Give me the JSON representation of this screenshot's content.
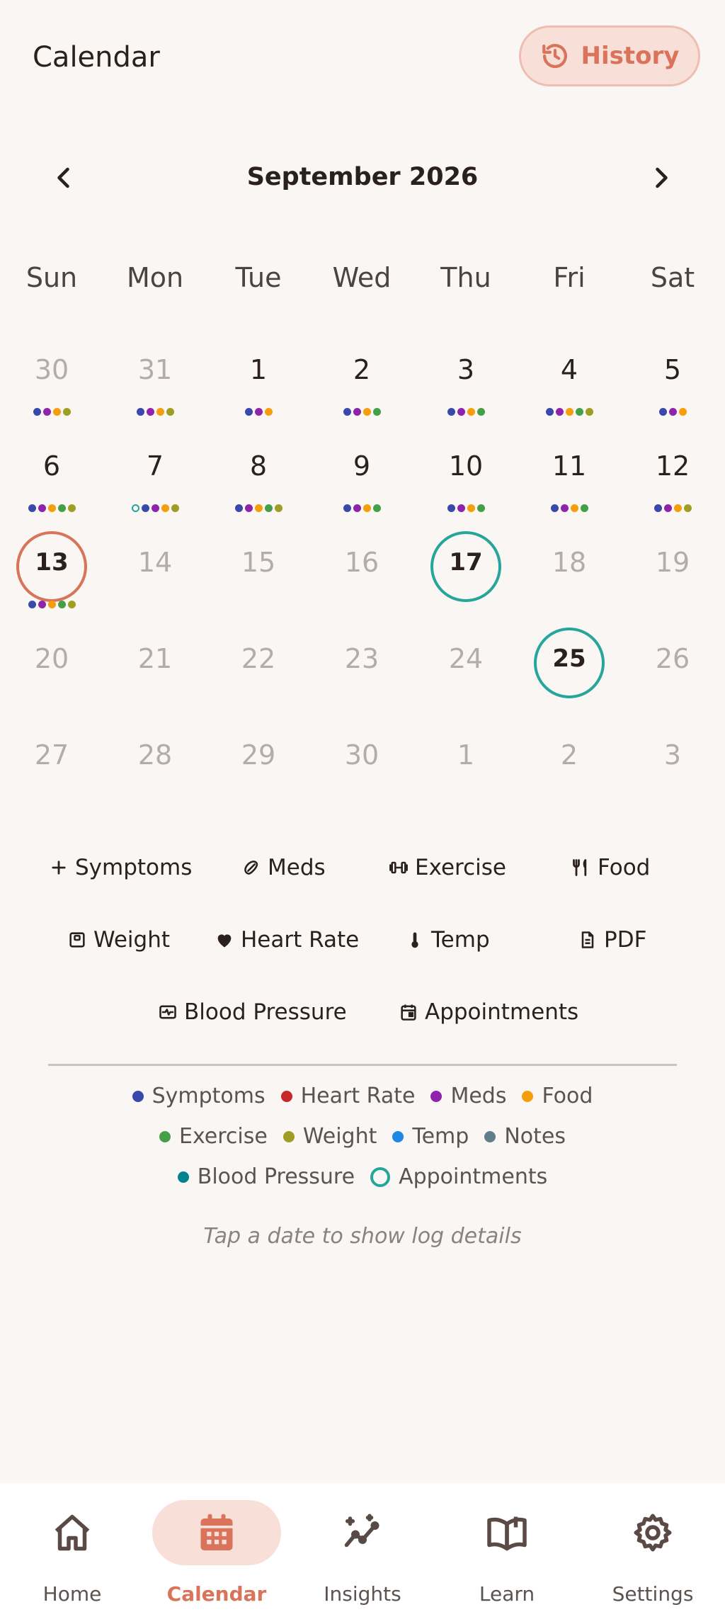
{
  "header": {
    "title": "Calendar",
    "history_label": "History"
  },
  "month": {
    "label": "September 2026"
  },
  "weekdays": [
    "Sun",
    "Mon",
    "Tue",
    "Wed",
    "Thu",
    "Fri",
    "Sat"
  ],
  "colors": {
    "symptoms": "#3949ab",
    "heart_rate": "#c62828",
    "meds": "#8e24aa",
    "food": "#f59e0b",
    "exercise": "#43a047",
    "weight": "#9e9d24",
    "temp": "#1e88e5",
    "notes": "#607d8b",
    "blood_pressure": "#00838f",
    "appointments": "#26a69a",
    "accent": "#d9735a"
  },
  "days": [
    {
      "label": "30",
      "muted": true,
      "dots": [
        "symptoms",
        "meds",
        "food",
        "weight"
      ]
    },
    {
      "label": "31",
      "muted": true,
      "dots": [
        "symptoms",
        "meds",
        "food",
        "weight"
      ]
    },
    {
      "label": "1",
      "dots": [
        "symptoms",
        "meds",
        "food"
      ]
    },
    {
      "label": "2",
      "dots": [
        "symptoms",
        "meds",
        "food",
        "exercise"
      ]
    },
    {
      "label": "3",
      "dots": [
        "symptoms",
        "meds",
        "food",
        "exercise"
      ]
    },
    {
      "label": "4",
      "dots": [
        "symptoms",
        "meds",
        "food",
        "exercise",
        "weight"
      ]
    },
    {
      "label": "5",
      "dots": [
        "symptoms",
        "meds",
        "food"
      ]
    },
    {
      "label": "6",
      "dots": [
        "symptoms",
        "meds",
        "food",
        "exercise",
        "weight"
      ]
    },
    {
      "label": "7",
      "dots": [
        "appointments",
        "symptoms",
        "meds",
        "food",
        "weight"
      ]
    },
    {
      "label": "8",
      "dots": [
        "symptoms",
        "meds",
        "food",
        "exercise",
        "weight"
      ]
    },
    {
      "label": "9",
      "dots": [
        "symptoms",
        "meds",
        "food",
        "exercise"
      ]
    },
    {
      "label": "10",
      "dots": [
        "symptoms",
        "meds",
        "food",
        "exercise"
      ]
    },
    {
      "label": "11",
      "dots": [
        "symptoms",
        "meds",
        "food",
        "exercise"
      ]
    },
    {
      "label": "12",
      "dots": [
        "symptoms",
        "meds",
        "food",
        "weight"
      ]
    },
    {
      "label": "13",
      "ring": "today",
      "dots": [
        "symptoms",
        "meds",
        "food",
        "exercise",
        "weight"
      ]
    },
    {
      "label": "14",
      "muted": true,
      "dots": []
    },
    {
      "label": "15",
      "muted": true,
      "dots": []
    },
    {
      "label": "16",
      "muted": true,
      "dots": []
    },
    {
      "label": "17",
      "ring": "appt",
      "dots": []
    },
    {
      "label": "18",
      "muted": true,
      "dots": []
    },
    {
      "label": "19",
      "muted": true,
      "dots": []
    },
    {
      "label": "20",
      "muted": true,
      "dots": []
    },
    {
      "label": "21",
      "muted": true,
      "dots": []
    },
    {
      "label": "22",
      "muted": true,
      "dots": []
    },
    {
      "label": "23",
      "muted": true,
      "dots": []
    },
    {
      "label": "24",
      "muted": true,
      "dots": []
    },
    {
      "label": "25",
      "ring": "appt",
      "dots": []
    },
    {
      "label": "26",
      "muted": true,
      "dots": []
    },
    {
      "label": "27",
      "muted": true,
      "dots": []
    },
    {
      "label": "28",
      "muted": true,
      "dots": []
    },
    {
      "label": "29",
      "muted": true,
      "dots": []
    },
    {
      "label": "30",
      "muted": true,
      "dots": []
    },
    {
      "label": "1",
      "muted": true,
      "dots": []
    },
    {
      "label": "2",
      "muted": true,
      "dots": []
    },
    {
      "label": "3",
      "muted": true,
      "dots": []
    }
  ],
  "actions": {
    "symptoms": "Symptoms",
    "meds": "Meds",
    "exercise": "Exercise",
    "food": "Food",
    "weight": "Weight",
    "heart_rate": "Heart Rate",
    "temp": "Temp",
    "pdf": "PDF",
    "blood_pressure": "Blood Pressure",
    "appointments": "Appointments"
  },
  "legend": {
    "symptoms": "Symptoms",
    "heart_rate": "Heart Rate",
    "meds": "Meds",
    "food": "Food",
    "exercise": "Exercise",
    "weight": "Weight",
    "temp": "Temp",
    "notes": "Notes",
    "blood_pressure": "Blood Pressure",
    "appointments": "Appointments"
  },
  "hint": "Tap a date to show log details",
  "nav": {
    "home": "Home",
    "calendar": "Calendar",
    "insights": "Insights",
    "learn": "Learn",
    "settings": "Settings"
  }
}
